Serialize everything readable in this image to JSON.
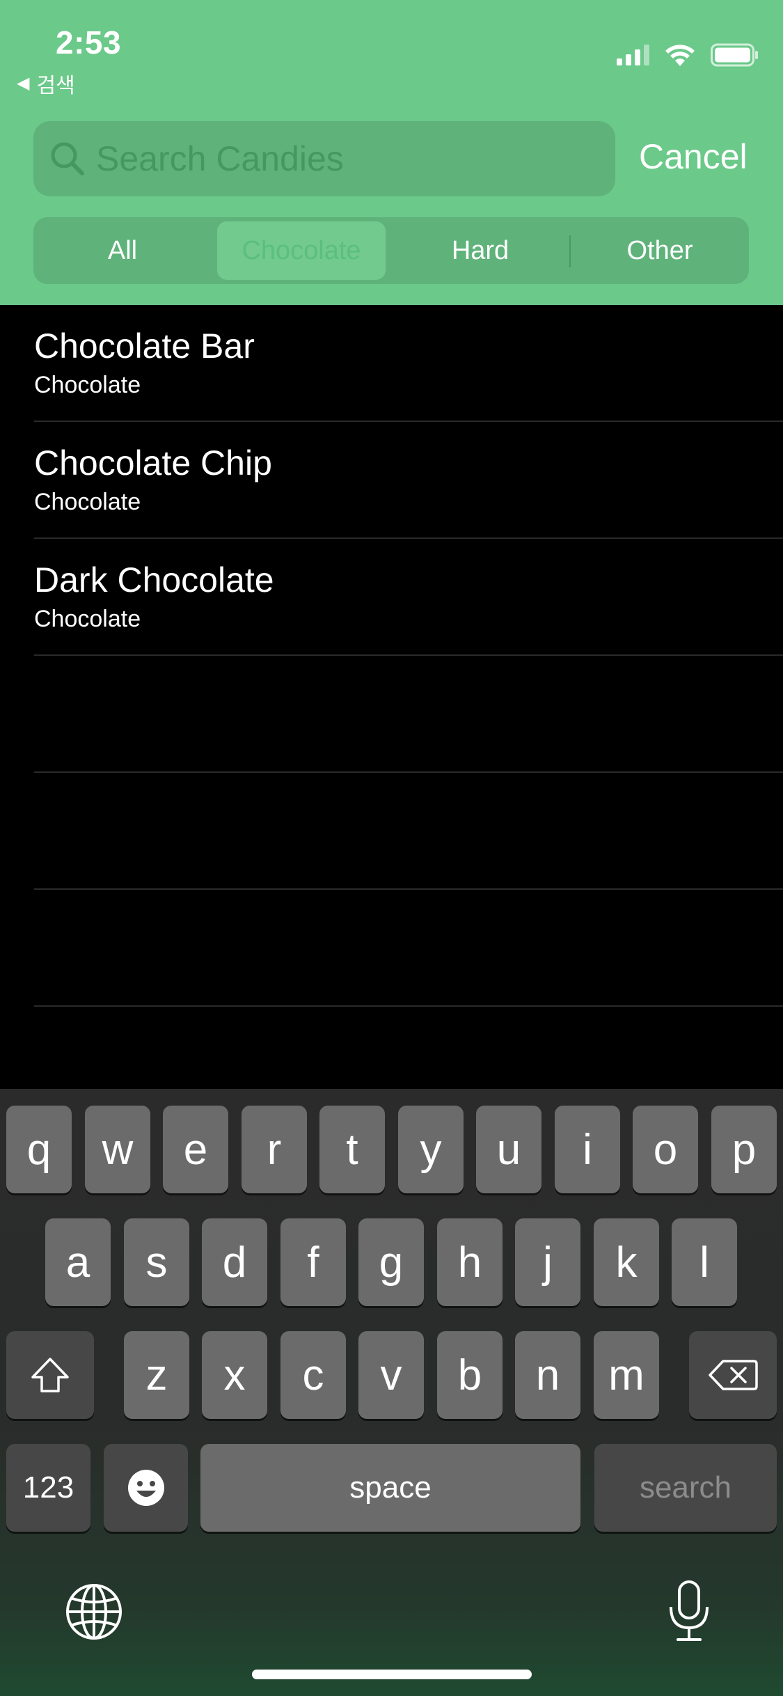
{
  "status_bar": {
    "time": "2:53",
    "back_app": "검색"
  },
  "search": {
    "placeholder": "Search Candies",
    "value": "",
    "cancel_label": "Cancel"
  },
  "scope": {
    "options": [
      "All",
      "Chocolate",
      "Hard",
      "Other"
    ],
    "selected": "Chocolate"
  },
  "results": [
    {
      "name": "Chocolate Bar",
      "category": "Chocolate"
    },
    {
      "name": "Chocolate Chip",
      "category": "Chocolate"
    },
    {
      "name": "Dark Chocolate",
      "category": "Chocolate"
    }
  ],
  "keyboard": {
    "row1": [
      "q",
      "w",
      "e",
      "r",
      "t",
      "y",
      "u",
      "i",
      "o",
      "p"
    ],
    "row2": [
      "a",
      "s",
      "d",
      "f",
      "g",
      "h",
      "j",
      "k",
      "l"
    ],
    "row3": [
      "z",
      "x",
      "c",
      "v",
      "b",
      "n",
      "m"
    ],
    "numbers_label": "123",
    "space_label": "space",
    "return_label": "search"
  },
  "colors": {
    "header_green": "#6bc98a",
    "background": "#000000"
  }
}
